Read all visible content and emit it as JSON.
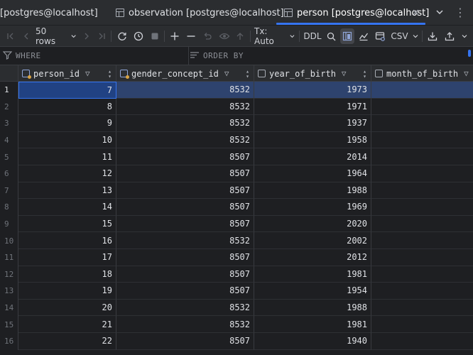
{
  "tabs": [
    {
      "label": "[postgres@localhost]",
      "active": false
    },
    {
      "label": "observation [postgres@localhost]",
      "active": false
    },
    {
      "label": "person [postgres@localhost]",
      "active": true
    }
  ],
  "toolbar": {
    "rows_label": "50 rows",
    "tx_label": "Tx: Auto",
    "ddl_label": "DDL",
    "csv_label": "CSV"
  },
  "filter": {
    "where_label": "WHERE",
    "orderby_label": "ORDER BY"
  },
  "table": {
    "columns": [
      "person_id",
      "gender_concept_id",
      "year_of_birth",
      "month_of_birth"
    ],
    "rows": [
      {
        "num": "1",
        "cells": [
          "7",
          "8532",
          "1973",
          ""
        ]
      },
      {
        "num": "2",
        "cells": [
          "8",
          "8532",
          "1971",
          ""
        ]
      },
      {
        "num": "3",
        "cells": [
          "9",
          "8532",
          "1937",
          ""
        ]
      },
      {
        "num": "4",
        "cells": [
          "10",
          "8532",
          "1958",
          ""
        ]
      },
      {
        "num": "5",
        "cells": [
          "11",
          "8507",
          "2014",
          ""
        ]
      },
      {
        "num": "6",
        "cells": [
          "12",
          "8507",
          "1964",
          ""
        ]
      },
      {
        "num": "7",
        "cells": [
          "13",
          "8507",
          "1988",
          ""
        ]
      },
      {
        "num": "8",
        "cells": [
          "14",
          "8507",
          "1969",
          ""
        ]
      },
      {
        "num": "9",
        "cells": [
          "15",
          "8507",
          "2020",
          ""
        ]
      },
      {
        "num": "10",
        "cells": [
          "16",
          "8532",
          "2002",
          ""
        ]
      },
      {
        "num": "11",
        "cells": [
          "17",
          "8507",
          "2012",
          ""
        ]
      },
      {
        "num": "12",
        "cells": [
          "18",
          "8507",
          "1981",
          ""
        ]
      },
      {
        "num": "13",
        "cells": [
          "19",
          "8507",
          "1954",
          ""
        ]
      },
      {
        "num": "14",
        "cells": [
          "20",
          "8532",
          "1988",
          ""
        ]
      },
      {
        "num": "15",
        "cells": [
          "21",
          "8532",
          "1981",
          ""
        ]
      },
      {
        "num": "16",
        "cells": [
          "22",
          "8507",
          "1940",
          ""
        ]
      }
    ]
  },
  "colors": {
    "accent": "#3574f0",
    "selected_row": "#2e436e",
    "background": "#1e1f22",
    "panel": "#2b2d30"
  }
}
